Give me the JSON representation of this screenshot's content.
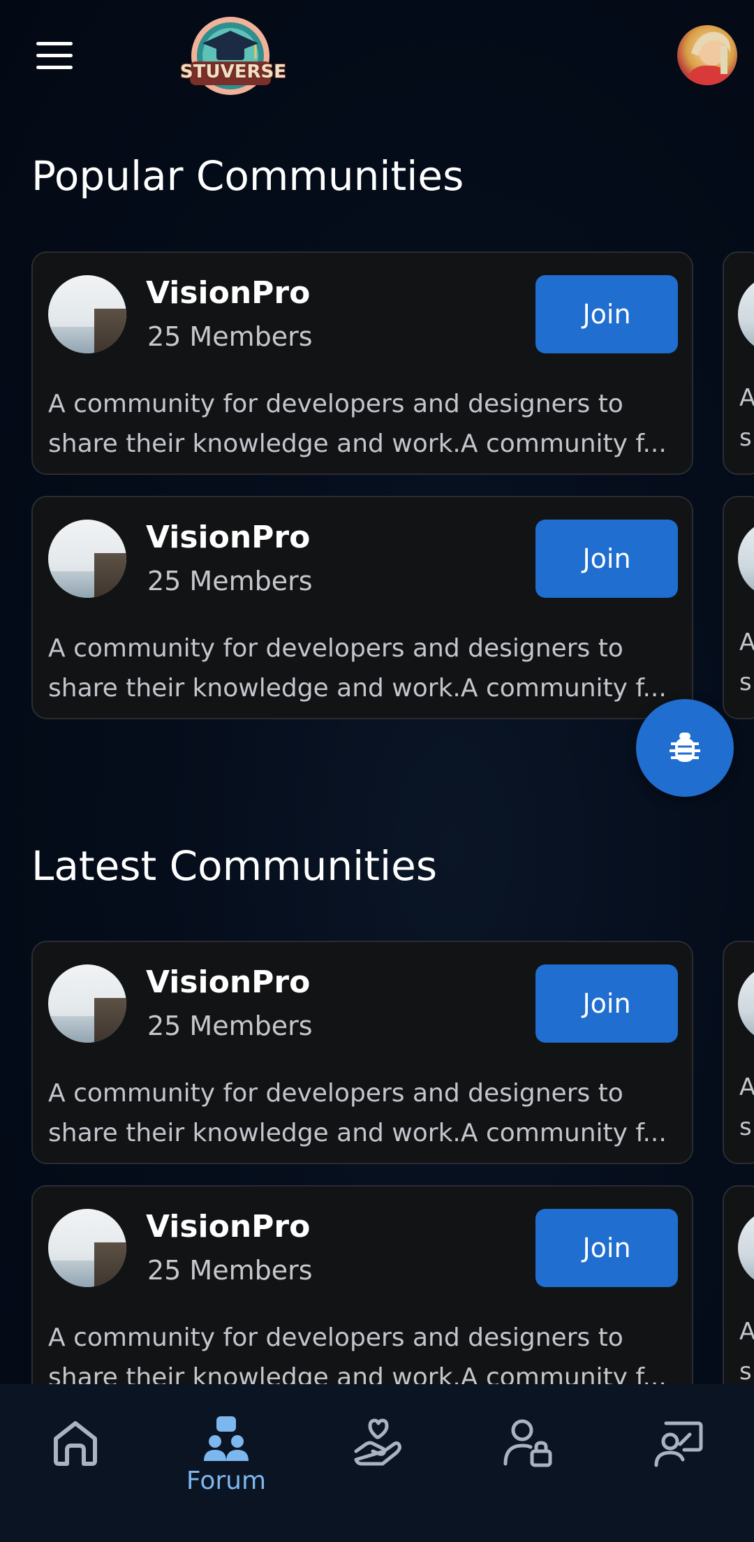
{
  "header": {
    "logo_text": "STUVERSE",
    "menu_icon": "hamburger-menu-icon",
    "avatar_icon": "user-avatar"
  },
  "sections": {
    "popular_title": "Popular Communities",
    "latest_title": "Latest Communities"
  },
  "community_card": {
    "name": "VisionPro",
    "members": "25 Members",
    "join_label": "Join",
    "description_line1": "A community for developers and designers to",
    "description_line2": "share their knowledge and work.A community f...",
    "peek_line1": "A",
    "peek_line2": "s"
  },
  "fab": {
    "icon": "bug-icon"
  },
  "bottom_nav": {
    "items": [
      {
        "icon": "home-icon",
        "label": ""
      },
      {
        "icon": "forum-icon",
        "label": "Forum",
        "active": true
      },
      {
        "icon": "hand-heart-icon",
        "label": ""
      },
      {
        "icon": "user-lock-icon",
        "label": ""
      },
      {
        "icon": "presentation-user-icon",
        "label": ""
      }
    ]
  },
  "colors": {
    "background": "#030a16",
    "card": "#121315",
    "accent": "#1f6ed0",
    "active_nav": "#7cb7f0"
  }
}
